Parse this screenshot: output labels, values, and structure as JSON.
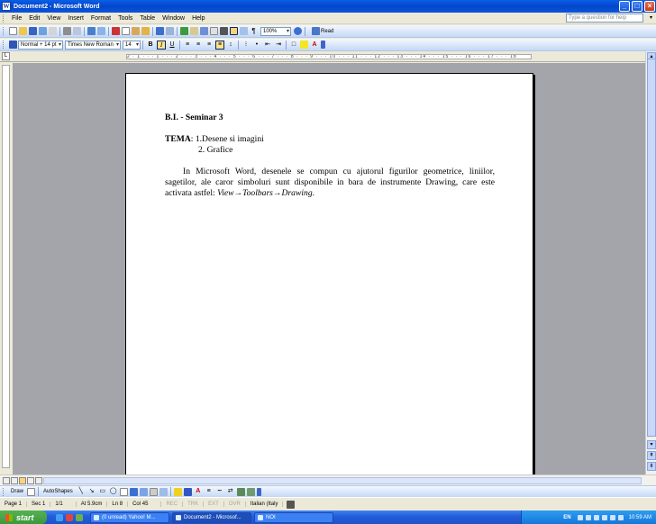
{
  "window": {
    "title": "Document2 - Microsoft Word",
    "app_icon": "word-icon"
  },
  "menu": {
    "items": [
      "File",
      "Edit",
      "View",
      "Insert",
      "Format",
      "Tools",
      "Table",
      "Window",
      "Help"
    ],
    "help_placeholder": "Type a question for help"
  },
  "standard_toolbar": {
    "zoom": "100%",
    "read_label": "Read"
  },
  "formatting_toolbar": {
    "style": "Normal + 14 pt",
    "font": "Times New Roman",
    "size": "14"
  },
  "ruler": {
    "ticks": "2 · 1 · · · 1 · · · 2 · · · 3 · · · 4 · · · 5 · · · 6 · · · 7 · · · 8 · · · 9 · · · 10 · · · 11 · · · 12 · · · 13 · · · 14 · · · 15 · · · 16 · · · 17 · · · 18"
  },
  "document": {
    "heading": "B.I. - Seminar 3",
    "tema_label": "TEMA",
    "tema_item1": ": 1.Desene si imagini",
    "tema_item2": "2. Grafice",
    "paragraph": "In Microsoft Word, desenele se compun cu ajutorul figurilor geometrice, liniilor, sagetilor, ale caror simboluri sunt disponibile in bara de instrumente Drawing, care este activata astfel: ",
    "menu_path": "View→Toolbars→Drawing",
    "paragraph_end": "."
  },
  "drawing_toolbar": {
    "draw_label": "Draw",
    "autoshapes_label": "AutoShapes"
  },
  "status": {
    "page": "Page 1",
    "sec": "Sec 1",
    "pages": "1/1",
    "at": "At 5.9cm",
    "ln": "Ln 8",
    "col": "Col 45",
    "rec": "REC",
    "trk": "TRK",
    "ext": "EXT",
    "ovr": "OVR",
    "language": "Italian (Italy"
  },
  "taskbar": {
    "start_label": "start",
    "tasks": [
      "(0 unread) Yahoo! M...",
      "Document2 - Microsof...",
      "NOI"
    ],
    "language": "EN",
    "clock": "10:59 AM"
  }
}
